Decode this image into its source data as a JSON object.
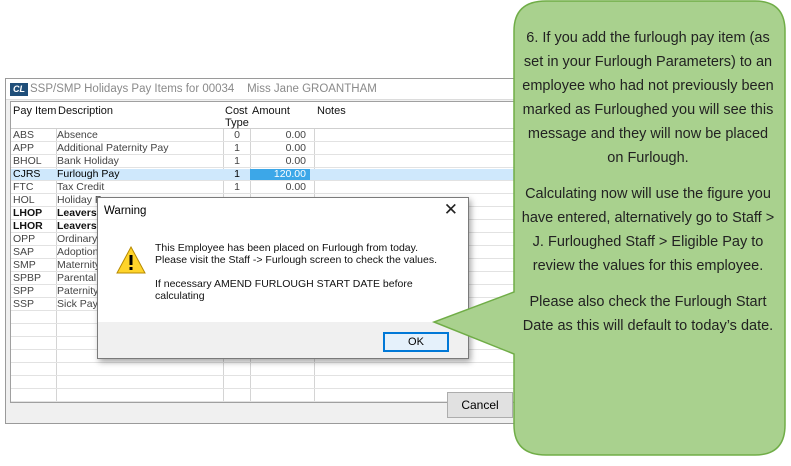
{
  "window": {
    "icon_text": "CL",
    "title": "SSP/SMP Holidays Pay Items for 00034    Miss Jane GROANTHAM"
  },
  "grid": {
    "columns": [
      "Pay Item",
      "Description",
      "Cost\nType",
      "Amount",
      "Notes"
    ],
    "rows": [
      {
        "code": "ABS",
        "desc": "Absence",
        "ct": "0",
        "amt": "0.00"
      },
      {
        "code": "APP",
        "desc": "Additional Paternity Pay",
        "ct": "1",
        "amt": "0.00"
      },
      {
        "code": "BHOL",
        "desc": "Bank Holiday",
        "ct": "1",
        "amt": "0.00"
      },
      {
        "code": "CJRS",
        "desc": "Furlough Pay",
        "ct": "1",
        "amt": "120.00"
      },
      {
        "code": "FTC",
        "desc": "Tax Credit",
        "ct": "1",
        "amt": "0.00"
      },
      {
        "code": "HOL",
        "desc": "Holiday P",
        "ct": "",
        "amt": ""
      },
      {
        "code": "LHOP",
        "desc": "Leavers H",
        "ct": "",
        "amt": ""
      },
      {
        "code": "LHOR",
        "desc": "Leavers H",
        "ct": "",
        "amt": ""
      },
      {
        "code": "OPP",
        "desc": "Ordinary",
        "ct": "",
        "amt": ""
      },
      {
        "code": "SAP",
        "desc": "Adoption",
        "ct": "",
        "amt": ""
      },
      {
        "code": "SMP",
        "desc": "Maternity",
        "ct": "",
        "amt": ""
      },
      {
        "code": "SPBP",
        "desc": "Parental",
        "ct": "",
        "amt": ""
      },
      {
        "code": "SPP",
        "desc": "Paternity",
        "ct": "",
        "amt": ""
      },
      {
        "code": "SSP",
        "desc": "Sick Pay",
        "ct": "",
        "amt": ""
      }
    ]
  },
  "buttons": {
    "cancel": "Cancel",
    "ok": "OK"
  },
  "dialog": {
    "title": "Warning",
    "close_glyph": "✕",
    "icon": "warning-icon",
    "line1": "This Employee has been placed on Furlough from today.",
    "line2": "Please visit the Staff -> Furlough screen to check the values.",
    "line3": "If necessary AMEND FURLOUGH START DATE before calculating"
  },
  "callout": {
    "p1": "6. If you add the furlough pay item (as set in your Furlough Parameters) to an employee who had not previously been marked as Furloughed you will see this message and they will now be placed on Furlough.",
    "p2": "Calculating now will use the figure you have entered, alternatively go to Staff > J. Furloughed Staff > Eligible Pay to review the values for this employee.",
    "p3": "Please also check the Furlough Start Date as this will default to today’s date.",
    "fill_color": "#a9d18e",
    "border_color": "#70ad47"
  }
}
